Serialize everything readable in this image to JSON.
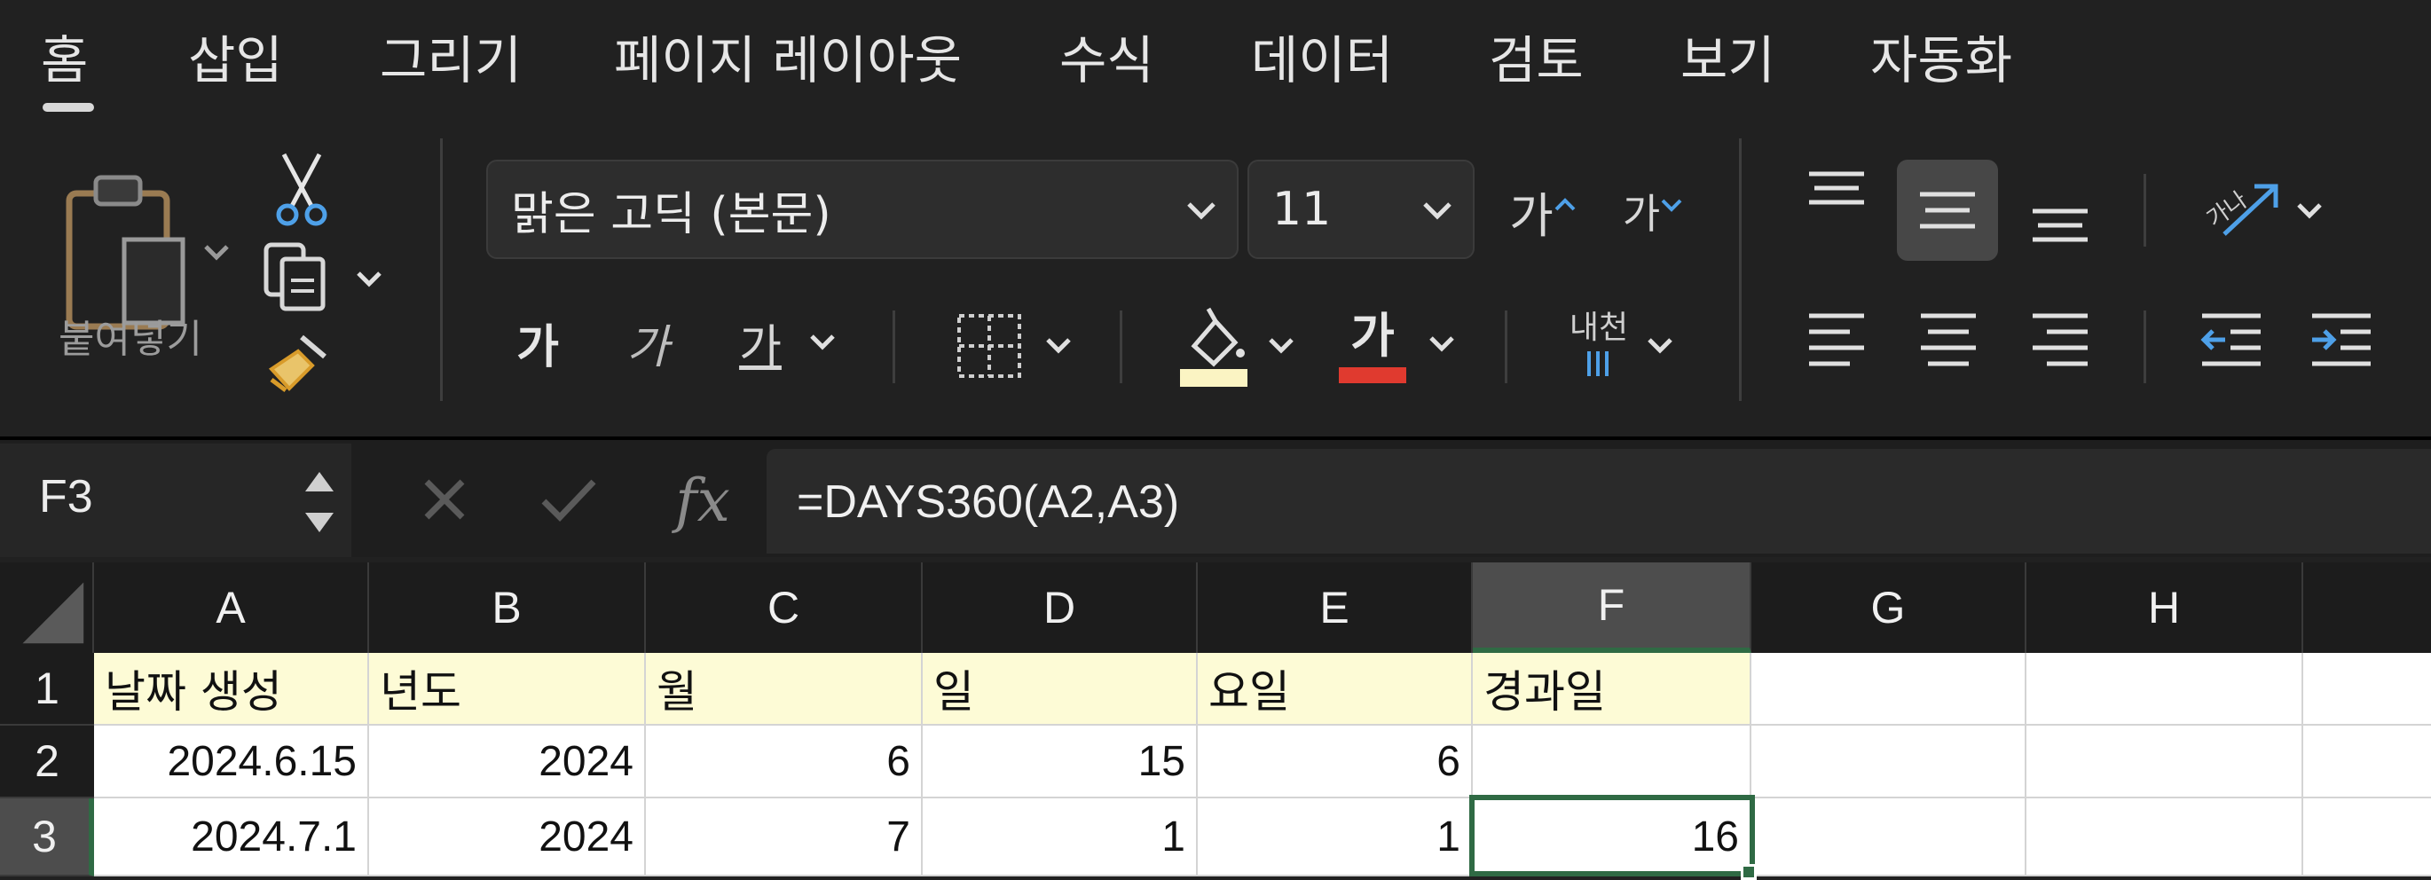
{
  "tabs": [
    {
      "label": "홈",
      "active": true
    },
    {
      "label": "삽입"
    },
    {
      "label": "그리기"
    },
    {
      "label": "페이지 레이아웃"
    },
    {
      "label": "수식"
    },
    {
      "label": "데이터"
    },
    {
      "label": "검토"
    },
    {
      "label": "보기"
    },
    {
      "label": "자동화"
    }
  ],
  "ribbon": {
    "paste_label": "붙여넣기",
    "font_name": "맑은 고딕 (본문)",
    "font_size": "11",
    "grow_font_glyph": "가",
    "shrink_font_glyph": "가",
    "bold_glyph": "가",
    "italic_glyph": "가",
    "underline_glyph": "가",
    "font_color_glyph": "가",
    "wrap_text_glyph": "내천",
    "orientation_glyph": "가나",
    "fill_color": "#fbf4c3",
    "font_color": "#e03a2f",
    "accent_blue": "#4ea0e8"
  },
  "formula_bar": {
    "name_box": "F3",
    "formula": "=DAYS360(A2,A3)",
    "fx_label": "fx"
  },
  "sheet": {
    "columns": [
      "A",
      "B",
      "C",
      "D",
      "E",
      "F",
      "G",
      "H"
    ],
    "rows": [
      "1",
      "2",
      "3"
    ],
    "selected_column": "F",
    "selected_row": "3",
    "cells": [
      [
        "날짜 생성",
        "년도",
        "월",
        "일",
        "요일",
        "경과일",
        "",
        ""
      ],
      [
        "2024.6.15",
        "2024",
        "6",
        "15",
        "6",
        "",
        "",
        ""
      ],
      [
        "2024.7.1",
        "2024",
        "7",
        "1",
        "1",
        "16",
        "",
        ""
      ]
    ],
    "header_fill": "#fdfbd6",
    "selection_color": "#2f6a44"
  }
}
